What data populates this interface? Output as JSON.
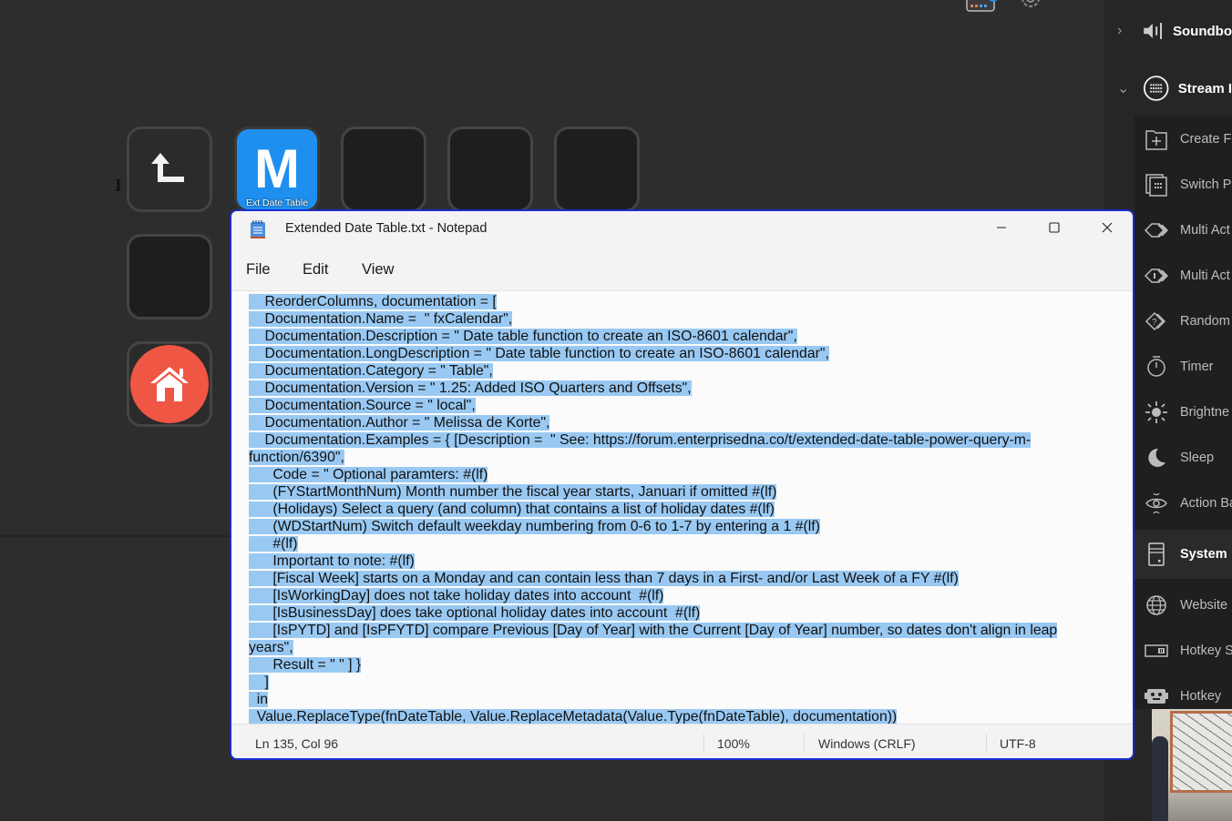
{
  "app": {
    "top_icons": [
      {
        "name": "keyboard-icon"
      },
      {
        "name": "settings-icon"
      }
    ]
  },
  "canvas": {
    "keys": [
      {
        "type": "back",
        "icon": "back-arrow-icon"
      },
      {
        "type": "action",
        "icon_letter": "M",
        "label": "Ext Date Table",
        "color": "#1e8fef"
      },
      {
        "type": "empty"
      },
      {
        "type": "empty"
      },
      {
        "type": "empty"
      },
      {
        "type": "empty"
      },
      {
        "type": "home",
        "icon": "home-icon",
        "color": "#ef5644"
      }
    ]
  },
  "sidebar": {
    "categories": [
      {
        "label": "Soundboard",
        "display": "Soundbo",
        "expanded": false,
        "chevron": "›",
        "icon": "speaker-icon"
      },
      {
        "label": "Stream Deck",
        "display": "Stream I",
        "expanded": true,
        "chevron": "⌄",
        "icon": "streamdeck-icon"
      }
    ],
    "actions": [
      {
        "label": "Create Folder",
        "display": "Create Fo",
        "icon": "folder-plus-icon"
      },
      {
        "label": "Switch Profile",
        "display": "Switch Pr",
        "icon": "switch-profile-icon"
      },
      {
        "label": "Multi Action",
        "display": "Multi Act",
        "icon": "multi-action-icon"
      },
      {
        "label": "Multi Action Switch",
        "display": "Multi Act",
        "icon": "multi-action-switch-icon"
      },
      {
        "label": "Random Action",
        "display": "Random",
        "icon": "random-action-icon"
      },
      {
        "label": "Timer",
        "display": "Timer",
        "icon": "timer-icon"
      },
      {
        "label": "Brightness",
        "display": "Brightne",
        "icon": "brightness-icon"
      },
      {
        "label": "Sleep",
        "display": "Sleep",
        "icon": "sleep-icon"
      },
      {
        "label": "Action Bar",
        "display": "Action Ba",
        "icon": "action-bar-icon"
      }
    ],
    "system_category": {
      "label": "System",
      "icon": "system-icon"
    },
    "system_actions": [
      {
        "label": "Website",
        "display": "Website",
        "icon": "globe-icon"
      },
      {
        "label": "Hotkey Switch",
        "display": "Hotkey S",
        "icon": "hotkey-switch-icon"
      },
      {
        "label": "Hotkey",
        "display": "Hotkey",
        "icon": "hotkey-icon"
      }
    ]
  },
  "notepad": {
    "title": "Extended Date Table.txt - Notepad",
    "menu": {
      "file": "File",
      "edit": "Edit",
      "view": "View"
    },
    "window_controls": {
      "minimize": "—",
      "maximize": "☐",
      "close": "✕"
    },
    "lines": [
      "    ReorderColumns, documentation = [",
      "    Documentation.Name =  \" fxCalendar\",",
      "    Documentation.Description = \" Date table function to create an ISO-8601 calendar\",",
      "    Documentation.LongDescription = \" Date table function to create an ISO-8601 calendar\",",
      "    Documentation.Category = \" Table\",",
      "    Documentation.Version = \" 1.25: Added ISO Quarters and Offsets\",",
      "    Documentation.Source = \" local\",",
      "    Documentation.Author = \" Melissa de Korte\",",
      "    Documentation.Examples = { [Description =  \" See: https://forum.enterprisedna.co/t/extended-date-table-power-query-m-",
      "function/6390\",",
      "      Code = \" Optional paramters: #(lf)",
      "      (FYStartMonthNum) Month number the fiscal year starts, Januari if omitted #(lf)",
      "      (Holidays) Select a query (and column) that contains a list of holiday dates #(lf)",
      "      (WDStartNum) Switch default weekday numbering from 0-6 to 1-7 by entering a 1 #(lf)",
      "      #(lf)",
      "      Important to note: #(lf)",
      "      [Fiscal Week] starts on a Monday and can contain less than 7 days in a First- and/or Last Week of a FY #(lf)",
      "      [IsWorkingDay] does not take holiday dates into account  #(lf)",
      "      [IsBusinessDay] does take optional holiday dates into account  #(lf)",
      "      [IsPYTD] and [IsPFYTD] compare Previous [Day of Year] with the Current [Day of Year] number, so dates don't align in leap",
      "years\",",
      "      Result = \" \" ] }",
      "    ]",
      "  in",
      "  Value.ReplaceType(fnDateTable, Value.ReplaceMetadata(Value.Type(fnDateTable), documentation))"
    ],
    "selection_color": "#99c9f3",
    "status": {
      "position": "Ln 135, Col 96",
      "zoom": "100%",
      "line_ending": "Windows (CRLF)",
      "encoding": "UTF-8"
    }
  }
}
